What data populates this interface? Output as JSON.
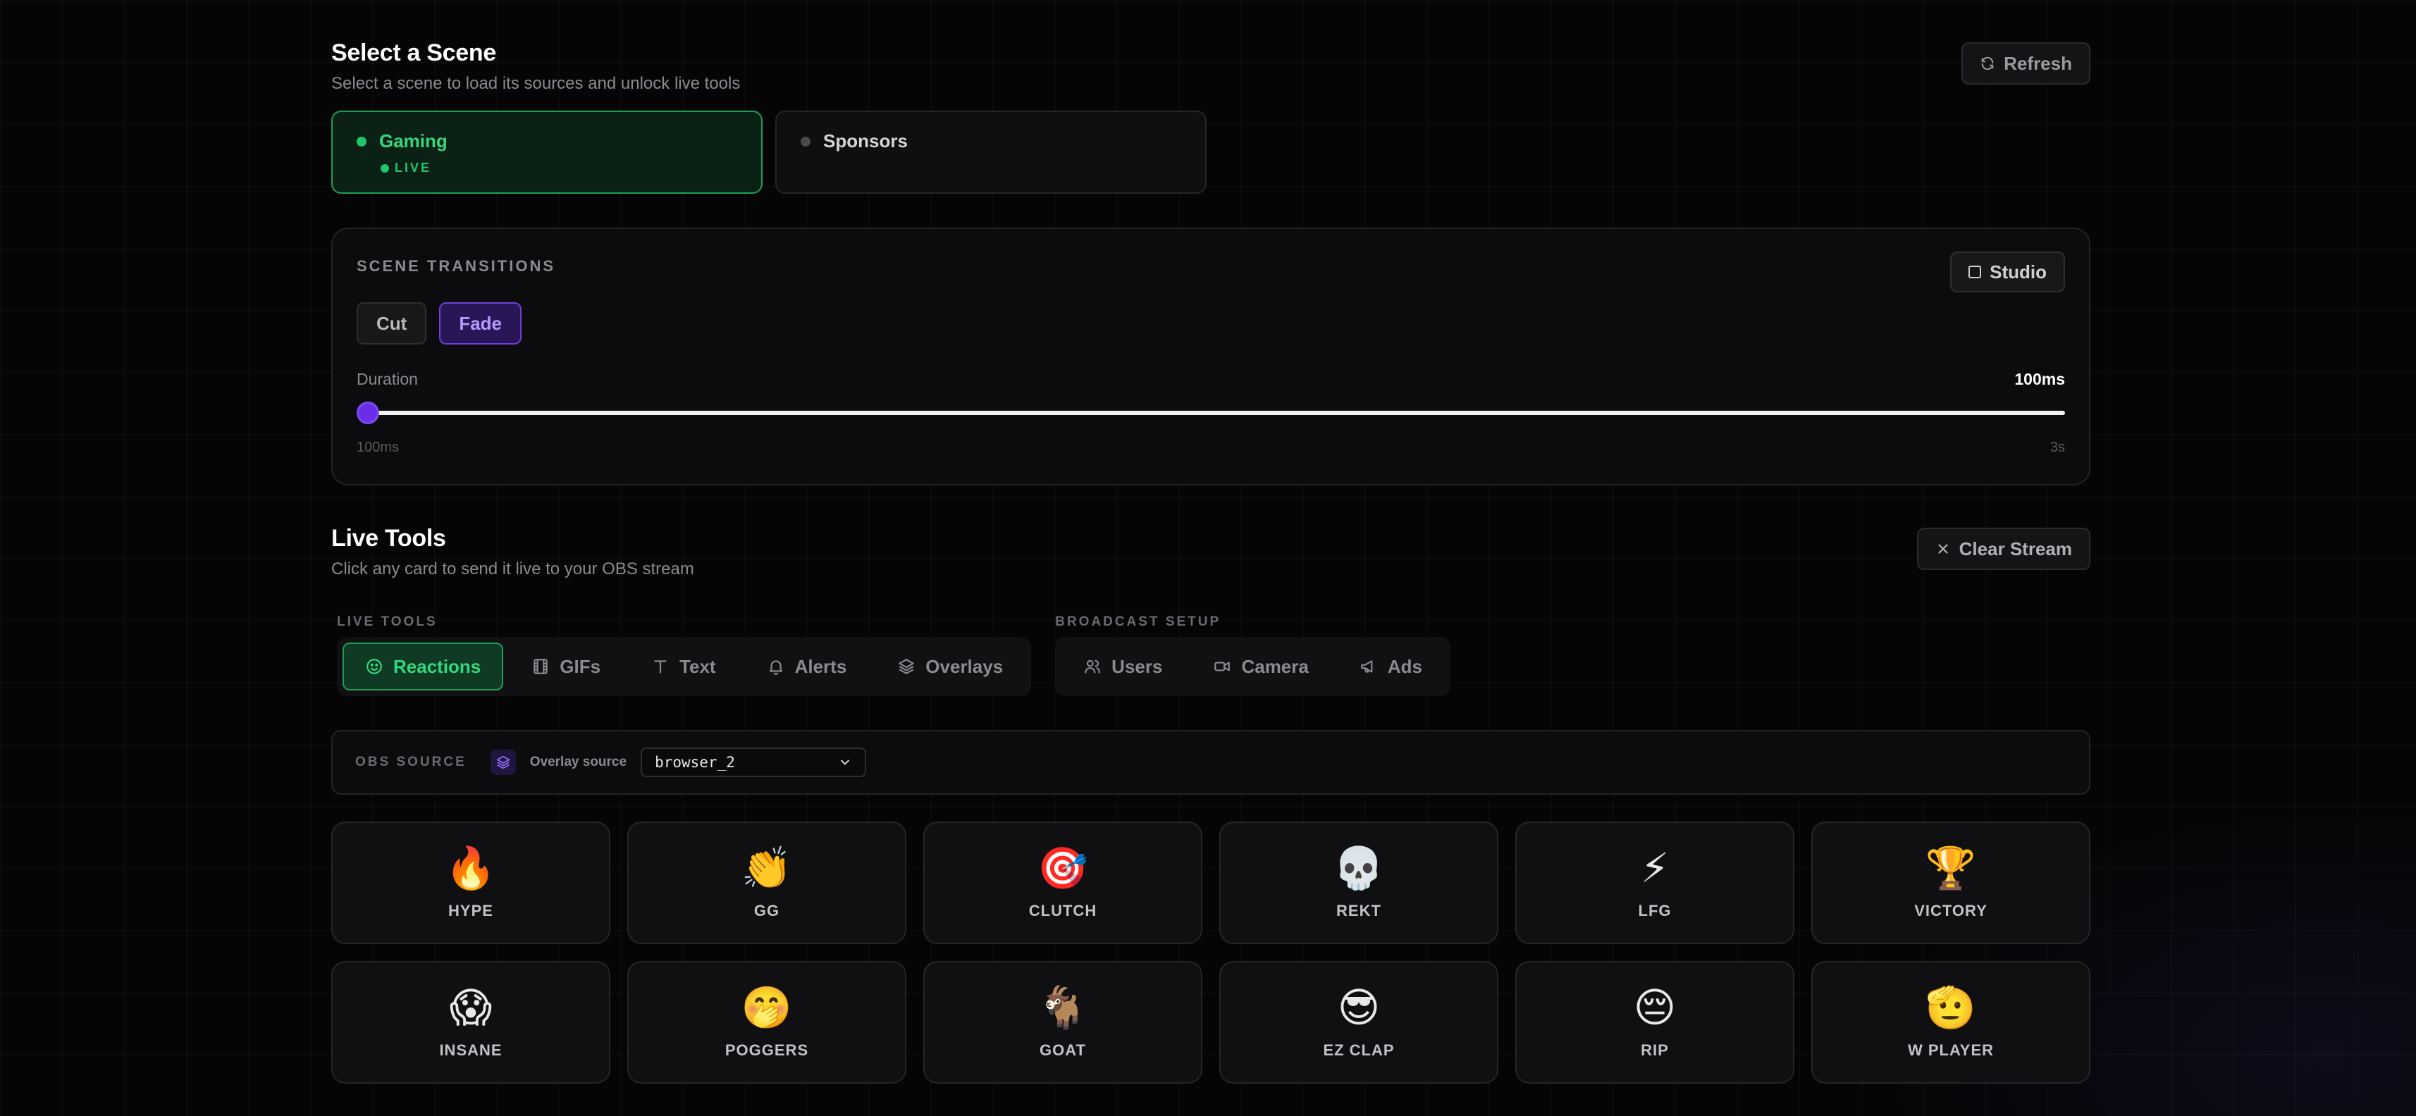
{
  "scene_section": {
    "title": "Select a Scene",
    "subtitle": "Select a scene to load its sources and unlock live tools",
    "refresh_label": "Refresh"
  },
  "scenes": [
    {
      "name": "Gaming",
      "status": "LIVE",
      "active": true
    },
    {
      "name": "Sponsors",
      "active": false
    }
  ],
  "transitions": {
    "label": "SCENE TRANSITIONS",
    "studio_label": "Studio",
    "options": [
      "Cut",
      "Fade"
    ],
    "selected": "Fade",
    "duration_label": "Duration",
    "duration_value": "100ms",
    "range_min": "100ms",
    "range_max": "3s",
    "slider_fraction": 0
  },
  "live_tools": {
    "title": "Live Tools",
    "subtitle": "Click any card to send it live to your OBS stream",
    "clear_label": "Clear Stream",
    "group_live": "LIVE TOOLS",
    "group_broadcast": "BROADCAST SETUP",
    "tabs_live": [
      {
        "label": "Reactions",
        "icon": "smile-icon",
        "active": true
      },
      {
        "label": "GIFs",
        "icon": "film-icon"
      },
      {
        "label": "Text",
        "icon": "text-icon"
      },
      {
        "label": "Alerts",
        "icon": "bell-icon"
      },
      {
        "label": "Overlays",
        "icon": "layers-icon"
      }
    ],
    "tabs_broadcast": [
      {
        "label": "Users",
        "icon": "users-icon"
      },
      {
        "label": "Camera",
        "icon": "camera-icon"
      },
      {
        "label": "Ads",
        "icon": "megaphone-icon"
      }
    ]
  },
  "obs_source": {
    "label": "OBS SOURCE",
    "overlay_label": "Overlay source",
    "selected": "browser_2"
  },
  "reactions": [
    {
      "emoji": "🔥",
      "label": "HYPE"
    },
    {
      "emoji": "👏",
      "label": "GG"
    },
    {
      "emoji": "🎯",
      "label": "CLUTCH"
    },
    {
      "emoji": "💀",
      "label": "REKT"
    },
    {
      "emoji": "⚡",
      "label": "LFG"
    },
    {
      "emoji": "🏆",
      "label": "VICTORY"
    },
    {
      "emoji": "😱",
      "label": "INSANE"
    },
    {
      "emoji": "🤭",
      "label": "POGGERS"
    },
    {
      "emoji": "🐐",
      "label": "GOAT"
    },
    {
      "emoji": "😎",
      "label": "EZ CLAP"
    },
    {
      "emoji": "😔",
      "label": "RIP"
    },
    {
      "emoji": "🫡",
      "label": "W PLAYER"
    }
  ],
  "colors": {
    "accent_green": "#22c56a",
    "accent_purple": "#6a2ee8",
    "background": "#050506"
  }
}
